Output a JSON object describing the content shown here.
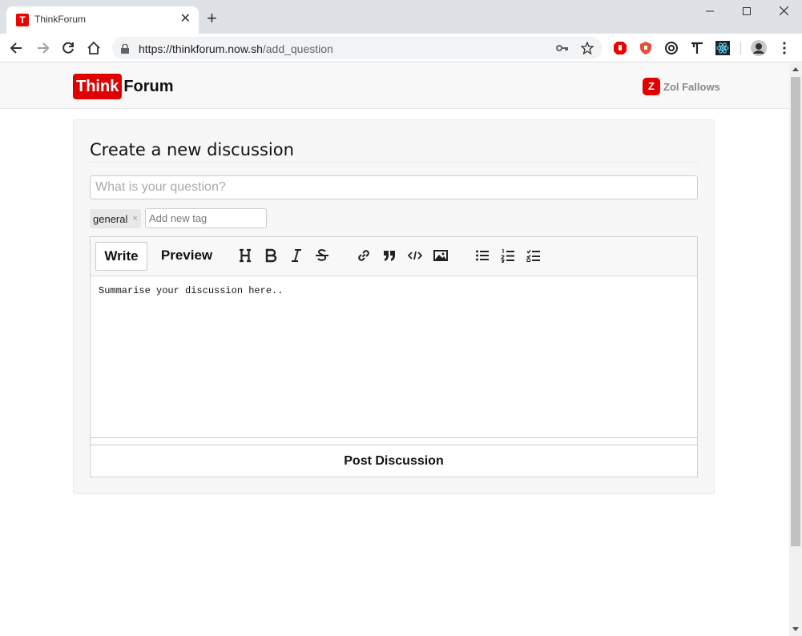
{
  "browser": {
    "tab_title": "ThinkForum",
    "tab_favicon_letter": "T",
    "url_host": "https://thinkforum.now.sh",
    "url_path": "/add_question",
    "icons": [
      "back-icon",
      "forward-icon",
      "reload-icon",
      "home-icon",
      "lock-icon",
      "key-icon",
      "star-icon",
      "extension-icons",
      "profile-avatar-icon",
      "menu-icon"
    ]
  },
  "header": {
    "logo_think": "Think",
    "logo_forum": "Forum",
    "user_initial": "Z",
    "user_name": "Zol Fallows"
  },
  "form": {
    "title": "Create a new discussion",
    "question_placeholder": "What is your question?",
    "tags": [
      "general"
    ],
    "tag_remove_symbol": "×",
    "tag_placeholder": "Add new tag",
    "editor_tabs": [
      "Write",
      "Preview"
    ],
    "active_tab": "Write",
    "editor_content": "Summarise your discussion here..",
    "submit_label": "Post Discussion"
  },
  "colors": {
    "brand_red": "#e00000",
    "card_bg": "#f7f7f7"
  }
}
